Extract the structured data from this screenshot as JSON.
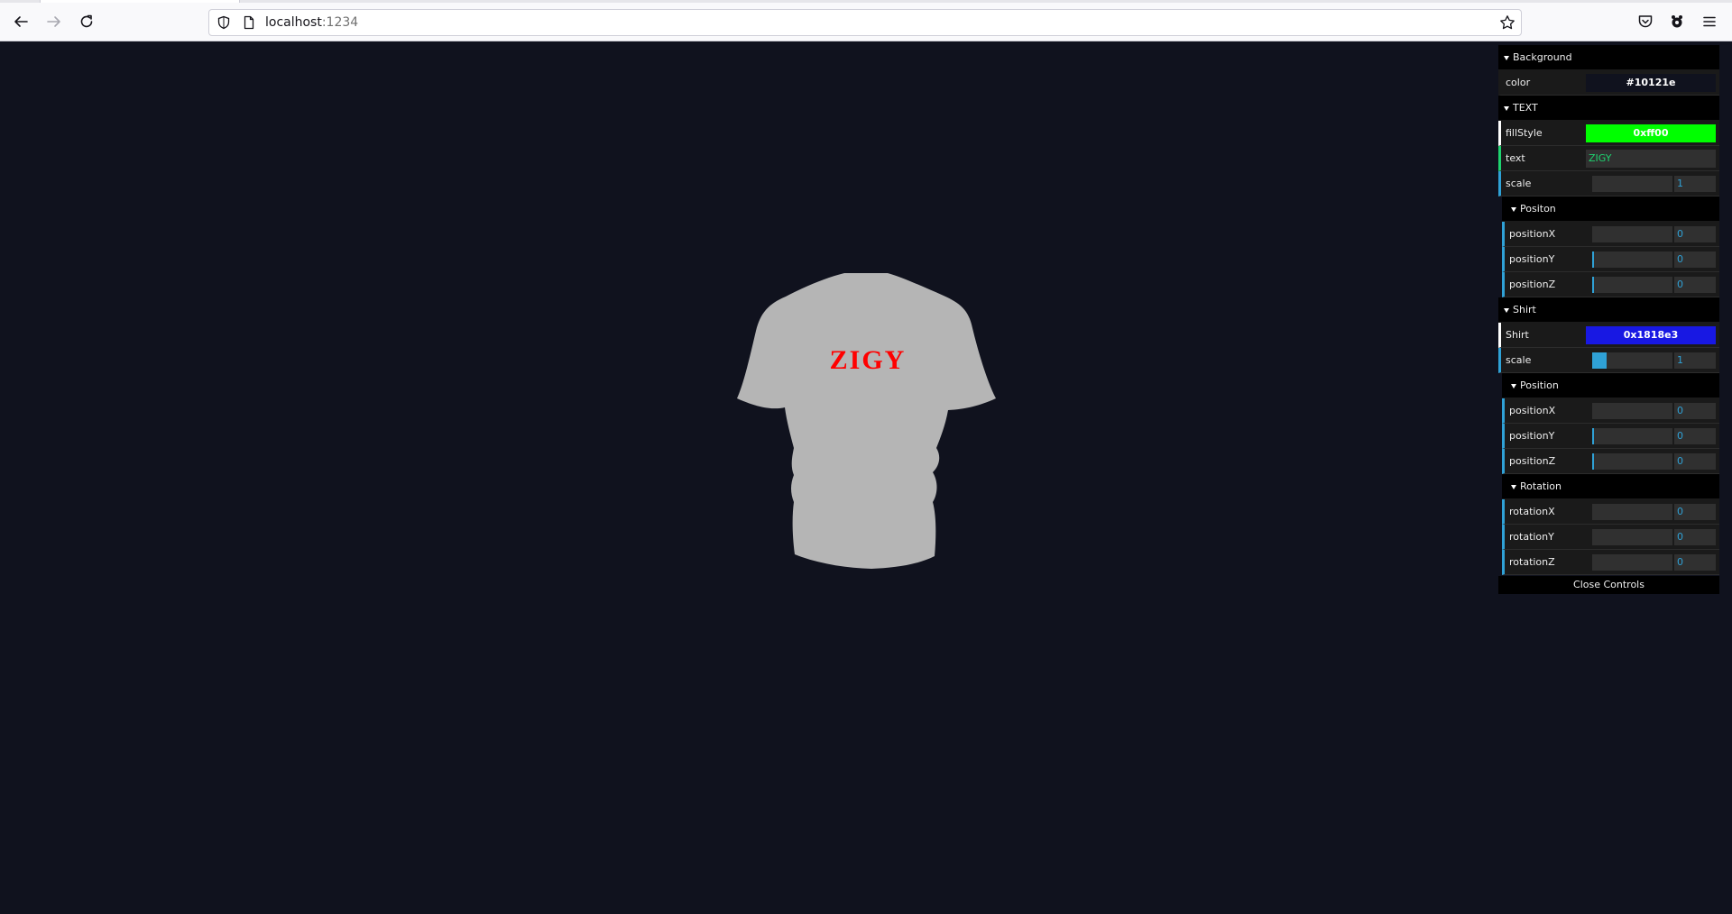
{
  "browser": {
    "url_host": "localhost",
    "url_port": ":1234"
  },
  "scene": {
    "background_color": "#10121e",
    "shirt_fill": "#b5b5b5",
    "shirt_text": "ZIGY",
    "shirt_text_color": "#ff0000"
  },
  "gui": {
    "background": {
      "title": "Background",
      "color_label": "color",
      "color_value": "#10121e"
    },
    "text": {
      "title": "TEXT",
      "fillstyle_label": "fillStyle",
      "fillstyle_value": "0xff00",
      "fillstyle_color": "#00ff00",
      "text_label": "text",
      "text_value": "ZIGY",
      "scale_label": "scale",
      "scale_value": "1",
      "scale_fill": 0,
      "position": {
        "title": "Positon",
        "rows": [
          {
            "label": "positionX",
            "value": "0",
            "fill": 0
          },
          {
            "label": "positionY",
            "value": "0",
            "fill": 0.02
          },
          {
            "label": "positionZ",
            "value": "0",
            "fill": 0.02
          }
        ]
      }
    },
    "shirt": {
      "title": "Shirt",
      "color_label": "Shirt",
      "color_value": "0x1818e3",
      "color_hex": "#1818e3",
      "scale_label": "scale",
      "scale_value": "1",
      "scale_fill": 0.18,
      "position": {
        "title": "Position",
        "rows": [
          {
            "label": "positionX",
            "value": "0",
            "fill": 0
          },
          {
            "label": "positionY",
            "value": "0",
            "fill": 0.02
          },
          {
            "label": "positionZ",
            "value": "0",
            "fill": 0.02
          }
        ]
      },
      "rotation": {
        "title": "Rotation",
        "rows": [
          {
            "label": "rotationX",
            "value": "0",
            "fill": 0
          },
          {
            "label": "rotationY",
            "value": "0",
            "fill": 0
          },
          {
            "label": "rotationZ",
            "value": "0",
            "fill": 0
          }
        ]
      }
    },
    "close_label": "Close Controls"
  }
}
